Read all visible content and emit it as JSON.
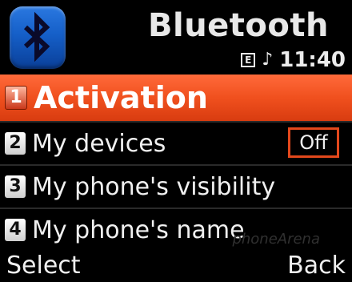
{
  "header": {
    "title": "Bluetooth",
    "logo_icon": "bluetooth-icon"
  },
  "status": {
    "memory_icon_letter": "E",
    "note_icon": "music-note-icon",
    "time": "11:40"
  },
  "menu": {
    "items": [
      {
        "number": "1",
        "label": "Activation",
        "selected": true
      },
      {
        "number": "2",
        "label": "My devices",
        "value": "Off"
      },
      {
        "number": "3",
        "label": "My phone's visibility"
      },
      {
        "number": "4",
        "label": "My phone's name"
      }
    ]
  },
  "softkeys": {
    "left": "Select",
    "right": "Back"
  },
  "watermark": "phoneArena",
  "colors": {
    "highlight": "#f0501e",
    "value_border": "#e3481c",
    "logo_blue": "#155fc8"
  }
}
